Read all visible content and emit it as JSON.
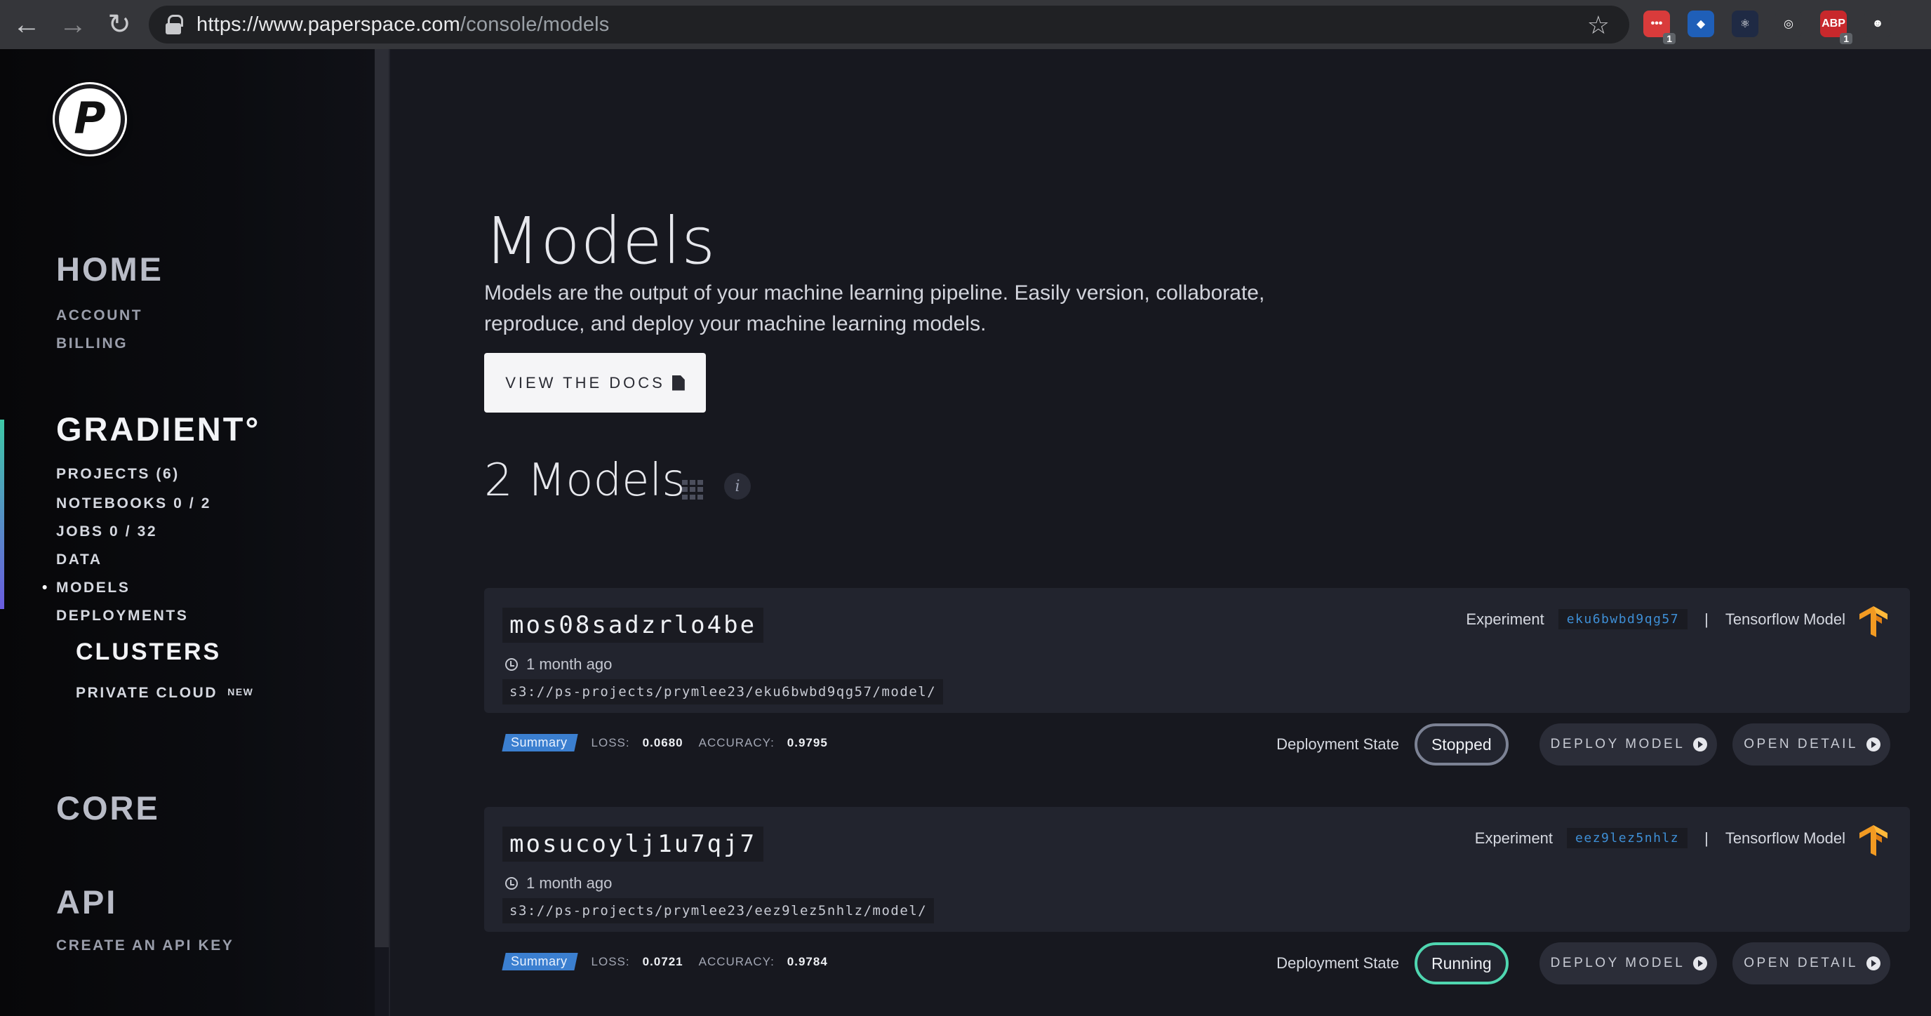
{
  "browser": {
    "url_host": "https://www.paperspace.com",
    "url_path": "/console/models",
    "extensions": [
      {
        "name": "todoist-extension-icon",
        "label": "•••",
        "badge": "1",
        "color": "#d93b3b"
      },
      {
        "name": "sketch-extension-icon",
        "label": "◆",
        "badge": "",
        "color": "#1f5fb8"
      },
      {
        "name": "react-devtools-icon",
        "label": "⚛",
        "badge": "",
        "color": "#1f2a44"
      },
      {
        "name": "target-extension-icon",
        "label": "◎",
        "badge": "",
        "color": "#35363a"
      },
      {
        "name": "adblock-icon",
        "label": "ABP",
        "badge": "1",
        "color": "#c8282c"
      },
      {
        "name": "ghost-extension-icon",
        "label": "☻",
        "badge": "",
        "color": "#35363a"
      }
    ]
  },
  "sidebar": {
    "home": "HOME",
    "account": "ACCOUNT",
    "billing": "BILLING",
    "gradient": "GRADIENT°",
    "projects": "PROJECTS (6)",
    "notebooks": "NOTEBOOKS 0 / 2",
    "jobs": "JOBS 0 / 32",
    "data": "DATA",
    "models": "MODELS",
    "deployments": "DEPLOYMENTS",
    "clusters": "CLUSTERS",
    "private_cloud": "PRIVATE CLOUD",
    "new_tag": "NEW",
    "core": "CORE",
    "api": "API",
    "create_api_key": "CREATE AN API KEY"
  },
  "main": {
    "title": "Models",
    "description": "Models are the output of your machine learning pipeline. Easily version, collaborate, reproduce, and deploy your machine learning models.",
    "docs_button": "VIEW THE DOCS",
    "count_title": "2 Models",
    "info_glyph": "i"
  },
  "models": [
    {
      "name": "mos08sadzrlo4be",
      "time": "1 month ago",
      "path": "s3://ps-projects/prymlee23/eku6bwbd9qg57/model/",
      "summary": "Summary",
      "loss_label": "LOSS:",
      "loss": "0.0680",
      "accuracy_label": "ACCURACY:",
      "accuracy": "0.9795",
      "experiment_label": "Experiment",
      "experiment_id": "eku6bwbd9qg57",
      "separator": "|",
      "model_type": "Tensorflow Model",
      "deployment_label": "Deployment State",
      "state": "Stopped",
      "deploy_button": "DEPLOY MODEL",
      "detail_button": "OPEN DETAIL"
    },
    {
      "name": "mosucoylj1u7qj7",
      "time": "1 month ago",
      "path": "s3://ps-projects/prymlee23/eez9lez5nhlz/model/",
      "summary": "Summary",
      "loss_label": "LOSS:",
      "loss": "0.0721",
      "accuracy_label": "ACCURACY:",
      "accuracy": "0.9784",
      "experiment_label": "Experiment",
      "experiment_id": "eez9lez5nhlz",
      "separator": "|",
      "model_type": "Tensorflow Model",
      "deployment_label": "Deployment State",
      "state": "Running",
      "deploy_button": "DEPLOY MODEL",
      "detail_button": "OPEN DETAIL"
    }
  ],
  "colors": {
    "accent_running": "#4fd6b0",
    "accent_blue": "#3b7fd0",
    "background": "#17181f"
  }
}
